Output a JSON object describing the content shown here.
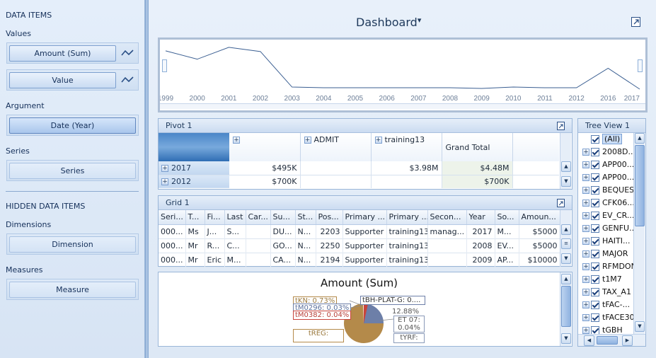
{
  "left": {
    "data_items_header": "DATA ITEMS",
    "values_label": "Values",
    "values": [
      "Amount (Sum)",
      "Value"
    ],
    "argument_label": "Argument",
    "argument": "Date (Year)",
    "series_label": "Series",
    "series": "Series",
    "hidden_header": "HIDDEN DATA ITEMS",
    "dimensions_label": "Dimensions",
    "dimension": "Dimension",
    "measures_label": "Measures",
    "measure": "Measure"
  },
  "dashboard": {
    "title": "Dashboard",
    "title_arrow": "▾"
  },
  "chart_data": {
    "type": "line",
    "x": [
      "1999",
      "2000",
      "2001",
      "2002",
      "2003",
      "2004",
      "2005",
      "2006",
      "2007",
      "2008",
      "2009",
      "2010",
      "2011",
      "2012",
      "2016",
      "2017"
    ],
    "values": [
      0.55,
      0.43,
      0.6,
      0.54,
      0.03,
      0.02,
      0.02,
      0.02,
      0.02,
      0.02,
      0.01,
      0.03,
      0.02,
      0.02,
      0.3,
      0.0
    ],
    "xlabel": "",
    "ylabel": "",
    "grid": false
  },
  "pivot": {
    "title": "Pivot 1",
    "col_headers": [
      "",
      "ADMIT",
      "training13",
      "Grand Total"
    ],
    "rows": [
      {
        "label": "2017",
        "cells": [
          "$495K",
          "",
          "$3.98M",
          "$4.48M"
        ]
      },
      {
        "label": "2012",
        "cells": [
          "$700K",
          "",
          "",
          "$700K"
        ]
      }
    ]
  },
  "grid": {
    "title": "Grid 1",
    "headers": [
      "Seri...",
      "T...",
      "Fi...",
      "Last",
      "Car...",
      "Su...",
      "St...",
      "Pos...",
      "Primary ...",
      "Primary ...",
      "Secon...",
      "Year",
      "So...",
      "Amoun..."
    ],
    "rows": [
      [
        "000...",
        "Ms",
        "J...",
        "S...",
        "",
        "DU...",
        "N...",
        "2203",
        "Supporter",
        "training13",
        "manag...",
        "2017",
        "M...",
        "$5000"
      ],
      [
        "000...",
        "Mr",
        "R...",
        "C...",
        "",
        "GO...",
        "N...",
        "2250",
        "Supporter",
        "training13",
        "",
        "2008",
        "EV...",
        "$5000"
      ],
      [
        "000...",
        "Mr",
        "Eric",
        "M...",
        "",
        "CA...",
        "N...",
        "2194",
        "Supporter",
        "training13",
        "",
        "2009",
        "AP...",
        "$10000"
      ]
    ]
  },
  "pie": {
    "title": "Amount (Sum)",
    "labels": [
      "tKN: 0.73%",
      "tM0296: 0.03%",
      "tM0382: 0.04%",
      "tBH-PLAT-G: 0....",
      "12.88%",
      "ET 07: 0.04%",
      "tREG:",
      "tYRF:"
    ]
  },
  "tree": {
    "title": "Tree View 1",
    "items": [
      "(All)",
      "2008D...",
      "APP00...",
      "APP00...",
      "BEQUES",
      "CFK06...",
      "EV_CR...",
      "GENFU...",
      "HAITI...",
      "MAJOR",
      "RFMDON",
      "t1M7",
      "TAX_A1",
      "tFAC-...",
      "tFACE30",
      "tGBH"
    ]
  },
  "colors": {
    "accent": "#1e395b",
    "pie_main": "#b48a4a",
    "pie_second": "#6d7fa8",
    "line": "#3b5f92"
  }
}
